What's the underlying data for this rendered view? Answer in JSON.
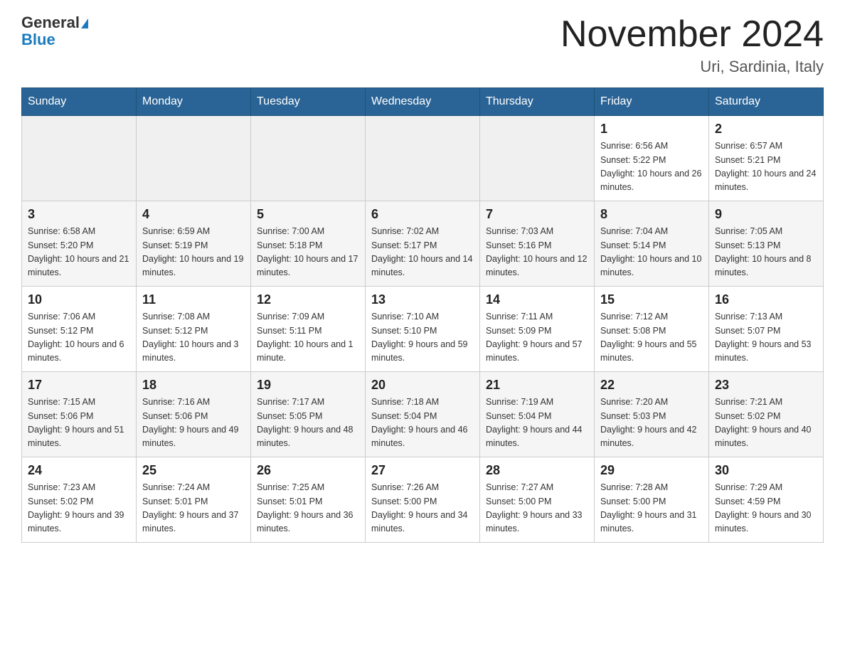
{
  "header": {
    "logo_line1": "General",
    "logo_line2": "Blue",
    "month_title": "November 2024",
    "location": "Uri, Sardinia, Italy"
  },
  "days_of_week": [
    "Sunday",
    "Monday",
    "Tuesday",
    "Wednesday",
    "Thursday",
    "Friday",
    "Saturday"
  ],
  "weeks": [
    [
      {
        "day": "",
        "info": ""
      },
      {
        "day": "",
        "info": ""
      },
      {
        "day": "",
        "info": ""
      },
      {
        "day": "",
        "info": ""
      },
      {
        "day": "",
        "info": ""
      },
      {
        "day": "1",
        "info": "Sunrise: 6:56 AM\nSunset: 5:22 PM\nDaylight: 10 hours and 26 minutes."
      },
      {
        "day": "2",
        "info": "Sunrise: 6:57 AM\nSunset: 5:21 PM\nDaylight: 10 hours and 24 minutes."
      }
    ],
    [
      {
        "day": "3",
        "info": "Sunrise: 6:58 AM\nSunset: 5:20 PM\nDaylight: 10 hours and 21 minutes."
      },
      {
        "day": "4",
        "info": "Sunrise: 6:59 AM\nSunset: 5:19 PM\nDaylight: 10 hours and 19 minutes."
      },
      {
        "day": "5",
        "info": "Sunrise: 7:00 AM\nSunset: 5:18 PM\nDaylight: 10 hours and 17 minutes."
      },
      {
        "day": "6",
        "info": "Sunrise: 7:02 AM\nSunset: 5:17 PM\nDaylight: 10 hours and 14 minutes."
      },
      {
        "day": "7",
        "info": "Sunrise: 7:03 AM\nSunset: 5:16 PM\nDaylight: 10 hours and 12 minutes."
      },
      {
        "day": "8",
        "info": "Sunrise: 7:04 AM\nSunset: 5:14 PM\nDaylight: 10 hours and 10 minutes."
      },
      {
        "day": "9",
        "info": "Sunrise: 7:05 AM\nSunset: 5:13 PM\nDaylight: 10 hours and 8 minutes."
      }
    ],
    [
      {
        "day": "10",
        "info": "Sunrise: 7:06 AM\nSunset: 5:12 PM\nDaylight: 10 hours and 6 minutes."
      },
      {
        "day": "11",
        "info": "Sunrise: 7:08 AM\nSunset: 5:12 PM\nDaylight: 10 hours and 3 minutes."
      },
      {
        "day": "12",
        "info": "Sunrise: 7:09 AM\nSunset: 5:11 PM\nDaylight: 10 hours and 1 minute."
      },
      {
        "day": "13",
        "info": "Sunrise: 7:10 AM\nSunset: 5:10 PM\nDaylight: 9 hours and 59 minutes."
      },
      {
        "day": "14",
        "info": "Sunrise: 7:11 AM\nSunset: 5:09 PM\nDaylight: 9 hours and 57 minutes."
      },
      {
        "day": "15",
        "info": "Sunrise: 7:12 AM\nSunset: 5:08 PM\nDaylight: 9 hours and 55 minutes."
      },
      {
        "day": "16",
        "info": "Sunrise: 7:13 AM\nSunset: 5:07 PM\nDaylight: 9 hours and 53 minutes."
      }
    ],
    [
      {
        "day": "17",
        "info": "Sunrise: 7:15 AM\nSunset: 5:06 PM\nDaylight: 9 hours and 51 minutes."
      },
      {
        "day": "18",
        "info": "Sunrise: 7:16 AM\nSunset: 5:06 PM\nDaylight: 9 hours and 49 minutes."
      },
      {
        "day": "19",
        "info": "Sunrise: 7:17 AM\nSunset: 5:05 PM\nDaylight: 9 hours and 48 minutes."
      },
      {
        "day": "20",
        "info": "Sunrise: 7:18 AM\nSunset: 5:04 PM\nDaylight: 9 hours and 46 minutes."
      },
      {
        "day": "21",
        "info": "Sunrise: 7:19 AM\nSunset: 5:04 PM\nDaylight: 9 hours and 44 minutes."
      },
      {
        "day": "22",
        "info": "Sunrise: 7:20 AM\nSunset: 5:03 PM\nDaylight: 9 hours and 42 minutes."
      },
      {
        "day": "23",
        "info": "Sunrise: 7:21 AM\nSunset: 5:02 PM\nDaylight: 9 hours and 40 minutes."
      }
    ],
    [
      {
        "day": "24",
        "info": "Sunrise: 7:23 AM\nSunset: 5:02 PM\nDaylight: 9 hours and 39 minutes."
      },
      {
        "day": "25",
        "info": "Sunrise: 7:24 AM\nSunset: 5:01 PM\nDaylight: 9 hours and 37 minutes."
      },
      {
        "day": "26",
        "info": "Sunrise: 7:25 AM\nSunset: 5:01 PM\nDaylight: 9 hours and 36 minutes."
      },
      {
        "day": "27",
        "info": "Sunrise: 7:26 AM\nSunset: 5:00 PM\nDaylight: 9 hours and 34 minutes."
      },
      {
        "day": "28",
        "info": "Sunrise: 7:27 AM\nSunset: 5:00 PM\nDaylight: 9 hours and 33 minutes."
      },
      {
        "day": "29",
        "info": "Sunrise: 7:28 AM\nSunset: 5:00 PM\nDaylight: 9 hours and 31 minutes."
      },
      {
        "day": "30",
        "info": "Sunrise: 7:29 AM\nSunset: 4:59 PM\nDaylight: 9 hours and 30 minutes."
      }
    ]
  ]
}
